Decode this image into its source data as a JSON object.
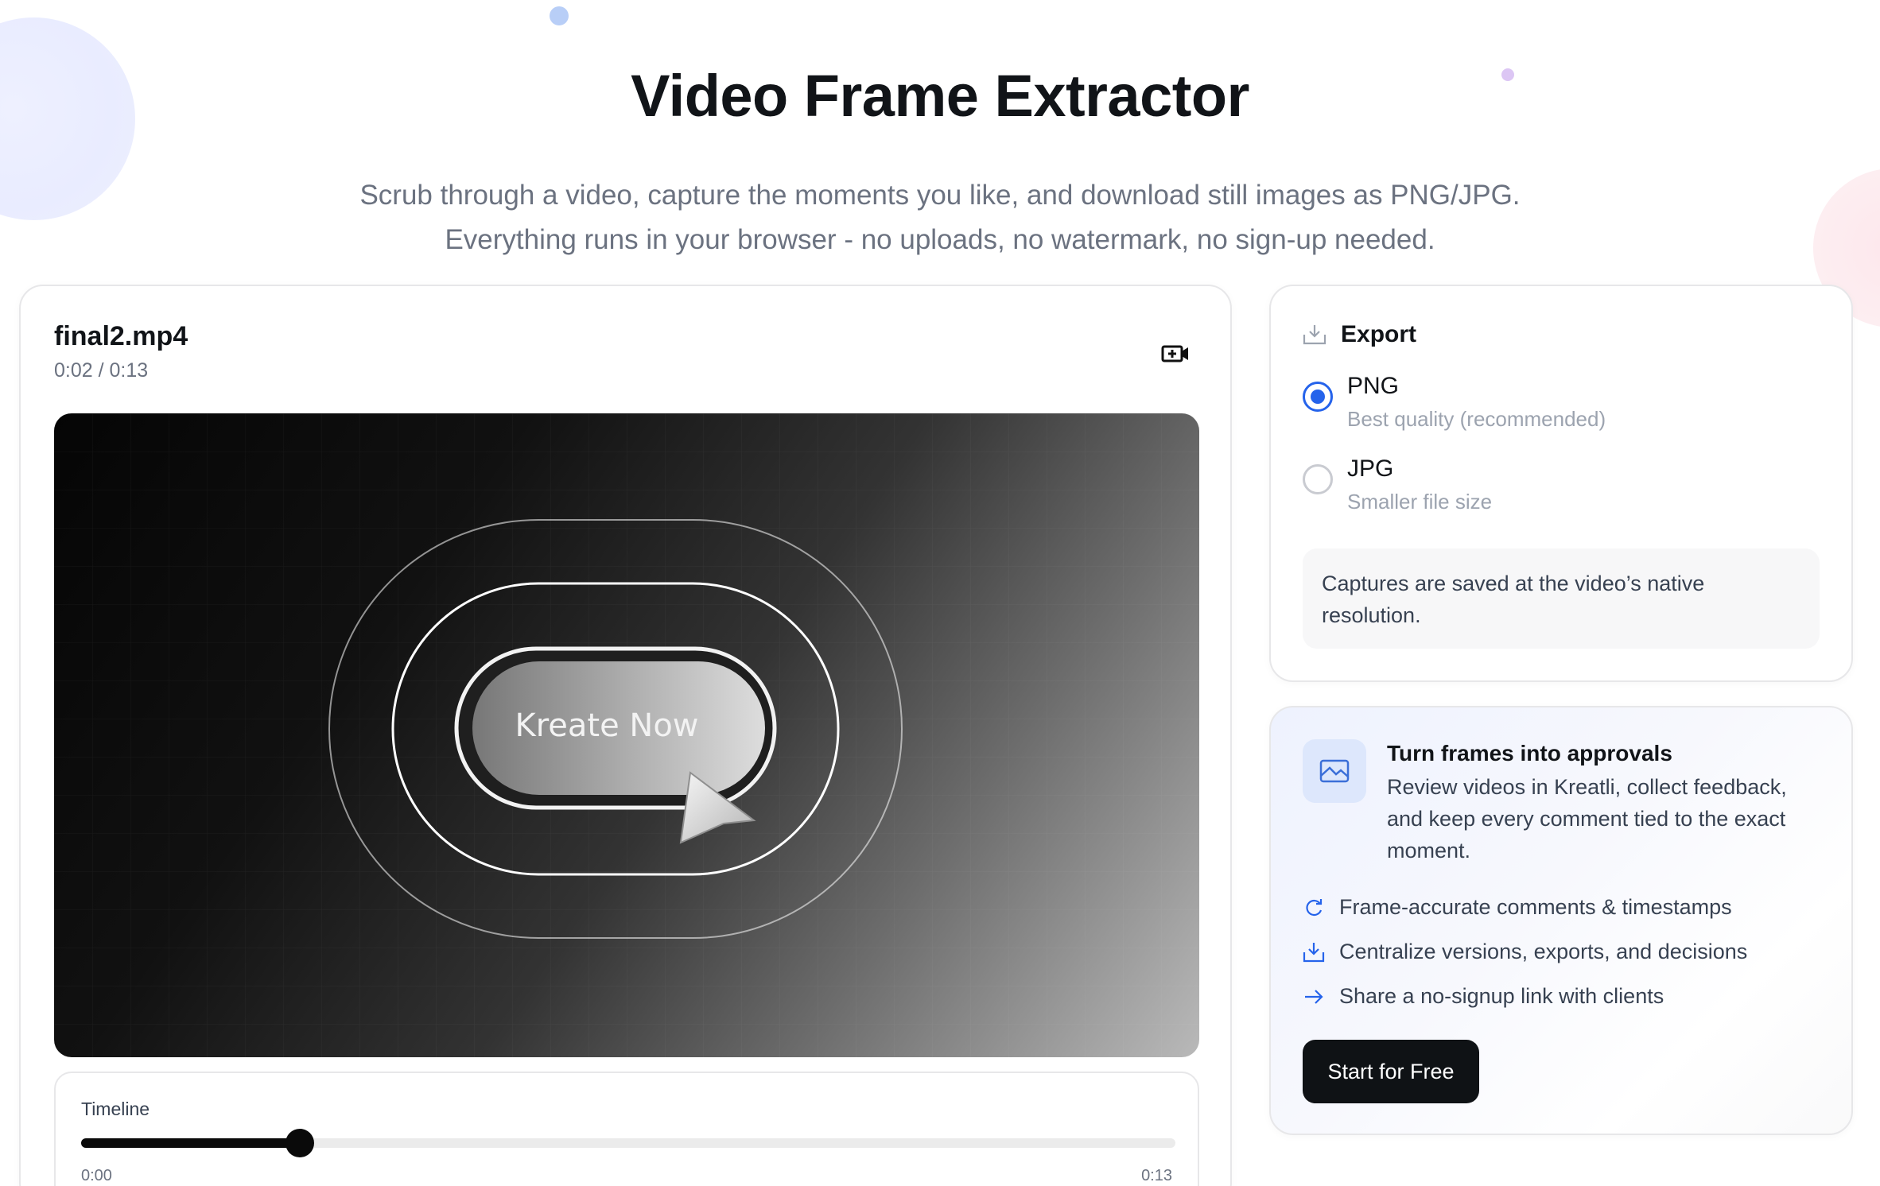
{
  "page": {
    "title": "Video Frame Extractor",
    "subtitle_line1": "Scrub through a video, capture the moments you like, and download still images as PNG/JPG.",
    "subtitle_line2": "Everything runs in your browser - no uploads, no watermark, no sign-up needed."
  },
  "video": {
    "file_name": "final2.mp4",
    "time_display": "0:02 / 0:13",
    "change_video_icon": "video-plus-icon",
    "frame_button_text": "Kreate Now"
  },
  "timeline": {
    "label": "Timeline",
    "start": "0:00",
    "end": "0:13",
    "progress": 0.2
  },
  "export": {
    "icon": "download-tray-icon",
    "title": "Export",
    "options": [
      {
        "label": "PNG",
        "description": "Best quality (recommended)",
        "selected": true
      },
      {
        "label": "JPG",
        "description": "Smaller file size",
        "selected": false
      }
    ],
    "note": "Captures are saved at the video’s native resolution."
  },
  "promo": {
    "icon": "image-icon",
    "title": "Turn frames into approvals",
    "text": "Review videos in Kreatli, collect feedback, and keep every comment tied to the exact moment.",
    "features": [
      {
        "icon": "refresh-icon",
        "label": "Frame-accurate comments & timestamps"
      },
      {
        "icon": "download-tray-icon",
        "label": "Centralize versions, exports, and decisions"
      },
      {
        "icon": "arrow-right-icon",
        "label": "Share a no-signup link with clients"
      }
    ],
    "cta": "Start for Free"
  },
  "colors": {
    "accent": "#2563eb",
    "dark": "#0f1215",
    "muted": "#6b7280"
  }
}
